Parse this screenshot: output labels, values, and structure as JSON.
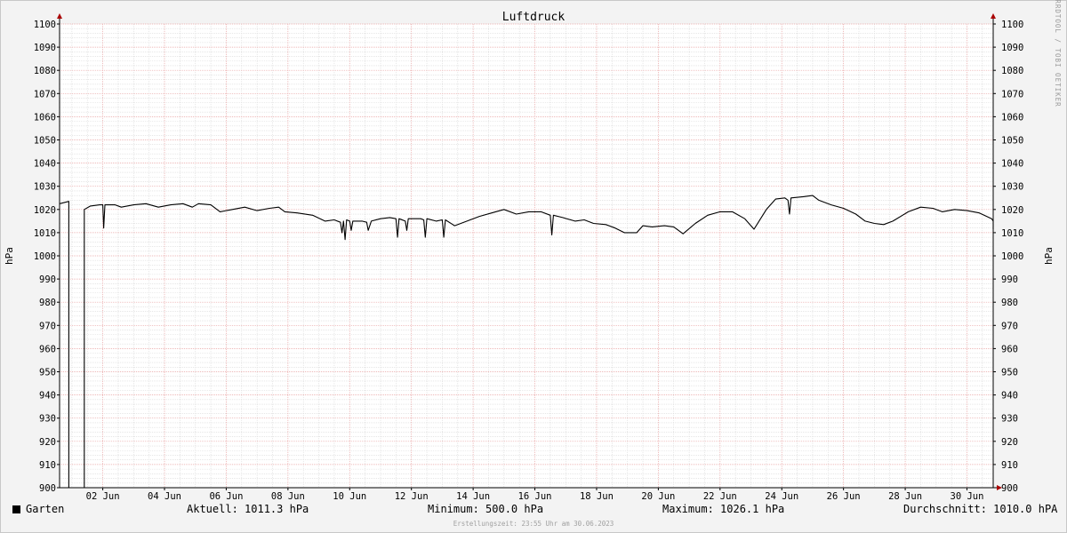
{
  "chart_data": {
    "type": "line",
    "title": "Luftdruck",
    "ylabel": "hPa",
    "watermark": "RRDTOOL / TOBI OETIKER",
    "ylim": [
      900,
      1100
    ],
    "ytick_step": 10,
    "xlim": [
      0.6,
      30.85
    ],
    "xlabel_unit": "day of June 2023",
    "xticks": [
      {
        "day": 2,
        "label": "02 Jun"
      },
      {
        "day": 4,
        "label": "04 Jun"
      },
      {
        "day": 6,
        "label": "06 Jun"
      },
      {
        "day": 8,
        "label": "08 Jun"
      },
      {
        "day": 10,
        "label": "10 Jun"
      },
      {
        "day": 12,
        "label": "12 Jun"
      },
      {
        "day": 14,
        "label": "14 Jun"
      },
      {
        "day": 16,
        "label": "16 Jun"
      },
      {
        "day": 18,
        "label": "18 Jun"
      },
      {
        "day": 20,
        "label": "20 Jun"
      },
      {
        "day": 22,
        "label": "22 Jun"
      },
      {
        "day": 24,
        "label": "24 Jun"
      },
      {
        "day": 26,
        "label": "26 Jun"
      },
      {
        "day": 28,
        "label": "28 Jun"
      },
      {
        "day": 30,
        "label": "30 Jun"
      }
    ],
    "grid": true,
    "series": [
      {
        "name": "Garten",
        "color": "#000000",
        "segments": [
          [
            [
              0.6,
              1022.5
            ],
            [
              0.9,
              1023.5
            ],
            [
              0.9,
              900
            ],
            [
              0.92,
              900
            ]
          ],
          [
            [
              1.4,
              900
            ],
            [
              1.4,
              1020
            ],
            [
              1.6,
              1021.5
            ],
            [
              1.9,
              1022
            ],
            [
              2.0,
              1022
            ],
            [
              2.03,
              1012
            ],
            [
              2.07,
              1022
            ],
            [
              2.4,
              1022
            ],
            [
              2.6,
              1021
            ],
            [
              3.0,
              1022
            ],
            [
              3.4,
              1022.5
            ],
            [
              3.8,
              1021
            ],
            [
              4.2,
              1022
            ],
            [
              4.6,
              1022.5
            ],
            [
              4.9,
              1021
            ],
            [
              5.1,
              1022.5
            ],
            [
              5.5,
              1022
            ],
            [
              5.8,
              1019
            ],
            [
              6.2,
              1020
            ],
            [
              6.6,
              1021
            ],
            [
              7.0,
              1019.5
            ],
            [
              7.4,
              1020.5
            ],
            [
              7.7,
              1021
            ],
            [
              7.9,
              1019
            ],
            [
              8.3,
              1018.5
            ],
            [
              8.8,
              1017.5
            ],
            [
              9.2,
              1015
            ],
            [
              9.5,
              1015.5
            ],
            [
              9.7,
              1014.5
            ],
            [
              9.75,
              1010
            ],
            [
              9.8,
              1015
            ],
            [
              9.85,
              1007
            ],
            [
              9.9,
              1015.5
            ],
            [
              10.0,
              1015
            ],
            [
              10.05,
              1011
            ],
            [
              10.1,
              1015
            ],
            [
              10.4,
              1015
            ],
            [
              10.55,
              1014.5
            ],
            [
              10.6,
              1011
            ],
            [
              10.7,
              1015
            ],
            [
              11.0,
              1016
            ],
            [
              11.3,
              1016.5
            ],
            [
              11.5,
              1016
            ],
            [
              11.55,
              1008
            ],
            [
              11.6,
              1016
            ],
            [
              11.8,
              1015
            ],
            [
              11.85,
              1011
            ],
            [
              11.9,
              1016
            ],
            [
              12.3,
              1016
            ],
            [
              12.4,
              1015.5
            ],
            [
              12.45,
              1008
            ],
            [
              12.5,
              1016
            ],
            [
              12.8,
              1015
            ],
            [
              13.0,
              1015.5
            ],
            [
              13.05,
              1008
            ],
            [
              13.1,
              1015.5
            ],
            [
              13.4,
              1013
            ],
            [
              13.8,
              1015
            ],
            [
              14.2,
              1017
            ],
            [
              14.6,
              1018.5
            ],
            [
              15.0,
              1020
            ],
            [
              15.4,
              1018
            ],
            [
              15.8,
              1019
            ],
            [
              16.2,
              1019
            ],
            [
              16.5,
              1017.5
            ],
            [
              16.55,
              1009
            ],
            [
              16.6,
              1017.5
            ],
            [
              16.9,
              1016.5
            ],
            [
              17.3,
              1015
            ],
            [
              17.6,
              1015.5
            ],
            [
              17.9,
              1014
            ],
            [
              18.3,
              1013.5
            ],
            [
              18.6,
              1012
            ],
            [
              18.9,
              1010
            ],
            [
              19.3,
              1010
            ],
            [
              19.5,
              1013
            ],
            [
              19.8,
              1012.5
            ],
            [
              20.2,
              1013
            ],
            [
              20.5,
              1012.5
            ],
            [
              20.8,
              1009.5
            ],
            [
              21.2,
              1014
            ],
            [
              21.6,
              1017.5
            ],
            [
              22.0,
              1019
            ],
            [
              22.4,
              1019
            ],
            [
              22.8,
              1016
            ],
            [
              23.1,
              1011.5
            ],
            [
              23.5,
              1020
            ],
            [
              23.8,
              1024.5
            ],
            [
              24.1,
              1025
            ],
            [
              24.2,
              1024
            ],
            [
              24.25,
              1018
            ],
            [
              24.3,
              1025
            ],
            [
              24.7,
              1025.5
            ],
            [
              25.0,
              1026
            ],
            [
              25.2,
              1024
            ],
            [
              25.6,
              1022
            ],
            [
              26.0,
              1020.5
            ],
            [
              26.4,
              1018
            ],
            [
              26.7,
              1015
            ],
            [
              27.0,
              1014
            ],
            [
              27.3,
              1013.5
            ],
            [
              27.6,
              1015
            ],
            [
              28.1,
              1019
            ],
            [
              28.5,
              1021
            ],
            [
              28.9,
              1020.5
            ],
            [
              29.2,
              1019
            ],
            [
              29.6,
              1020
            ],
            [
              30.0,
              1019.5
            ],
            [
              30.4,
              1018.5
            ],
            [
              30.8,
              1016
            ],
            [
              31.2,
              1015
            ],
            [
              31.6,
              1014
            ],
            [
              32.0,
              1014.5
            ],
            [
              32.4,
              1015
            ],
            [
              32.8,
              1012.5
            ],
            [
              33.1,
              1011.5
            ]
          ]
        ]
      }
    ]
  },
  "legend": {
    "series_name": "Garten",
    "aktuell": "Aktuell: 1011.3 hPa",
    "minimum": "Minimum: 500.0 hPa",
    "maximum": "Maximum: 1026.1 hPa",
    "durchschnitt": "Durchschnitt: 1010.0 hPA"
  },
  "footer": "Erstellungszeit: 23:55 Uhr am 30.06.2023",
  "colors": {
    "background": "#f3f3f3",
    "major_grid": "#e8a0a0",
    "minor_grid": "#d8d8d8",
    "axis_arrow": "#aa0000"
  }
}
